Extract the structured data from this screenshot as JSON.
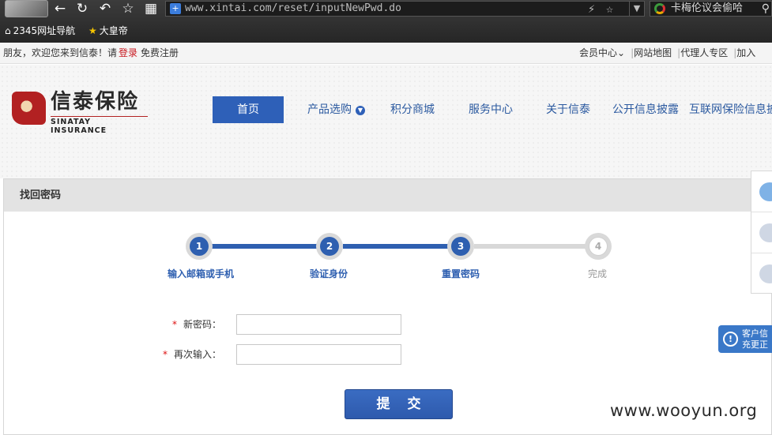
{
  "browser": {
    "url": "www.xintai.com/reset/inputNewPwd.do",
    "search_tab_text": "卡梅伦议会偷哈",
    "bookmarks": [
      "2345网址导航",
      "大皇帝"
    ]
  },
  "topbar": {
    "welcome": "朋友，欢迎您来到信泰！请",
    "login": "登录",
    "register": "免费注册",
    "links": [
      "会员中心",
      "网站地图",
      "代理人专区",
      "加入"
    ]
  },
  "logo": {
    "cn": "信泰保险",
    "en": "SINATAY INSURANCE"
  },
  "nav": [
    "首页",
    "产品选购",
    "积分商城",
    "服务中心",
    "关于信泰",
    "公开信息披露",
    "互联网保险信息披露"
  ],
  "panel_title": "找回密码",
  "steps": [
    {
      "num": "1",
      "label": "输入邮箱或手机",
      "done": true
    },
    {
      "num": "2",
      "label": "验证身份",
      "done": true
    },
    {
      "num": "3",
      "label": "重置密码",
      "done": true
    },
    {
      "num": "4",
      "label": "完成",
      "done": false
    }
  ],
  "form": {
    "required_mark": "*",
    "new_password_label": "新密码：",
    "new_password_value": "",
    "confirm_password_label": "再次输入：",
    "confirm_password_value": "",
    "submit": "提交"
  },
  "notice": {
    "line1": "客户信",
    "line2": "充更正"
  },
  "watermark": "www.wooyun.org"
}
